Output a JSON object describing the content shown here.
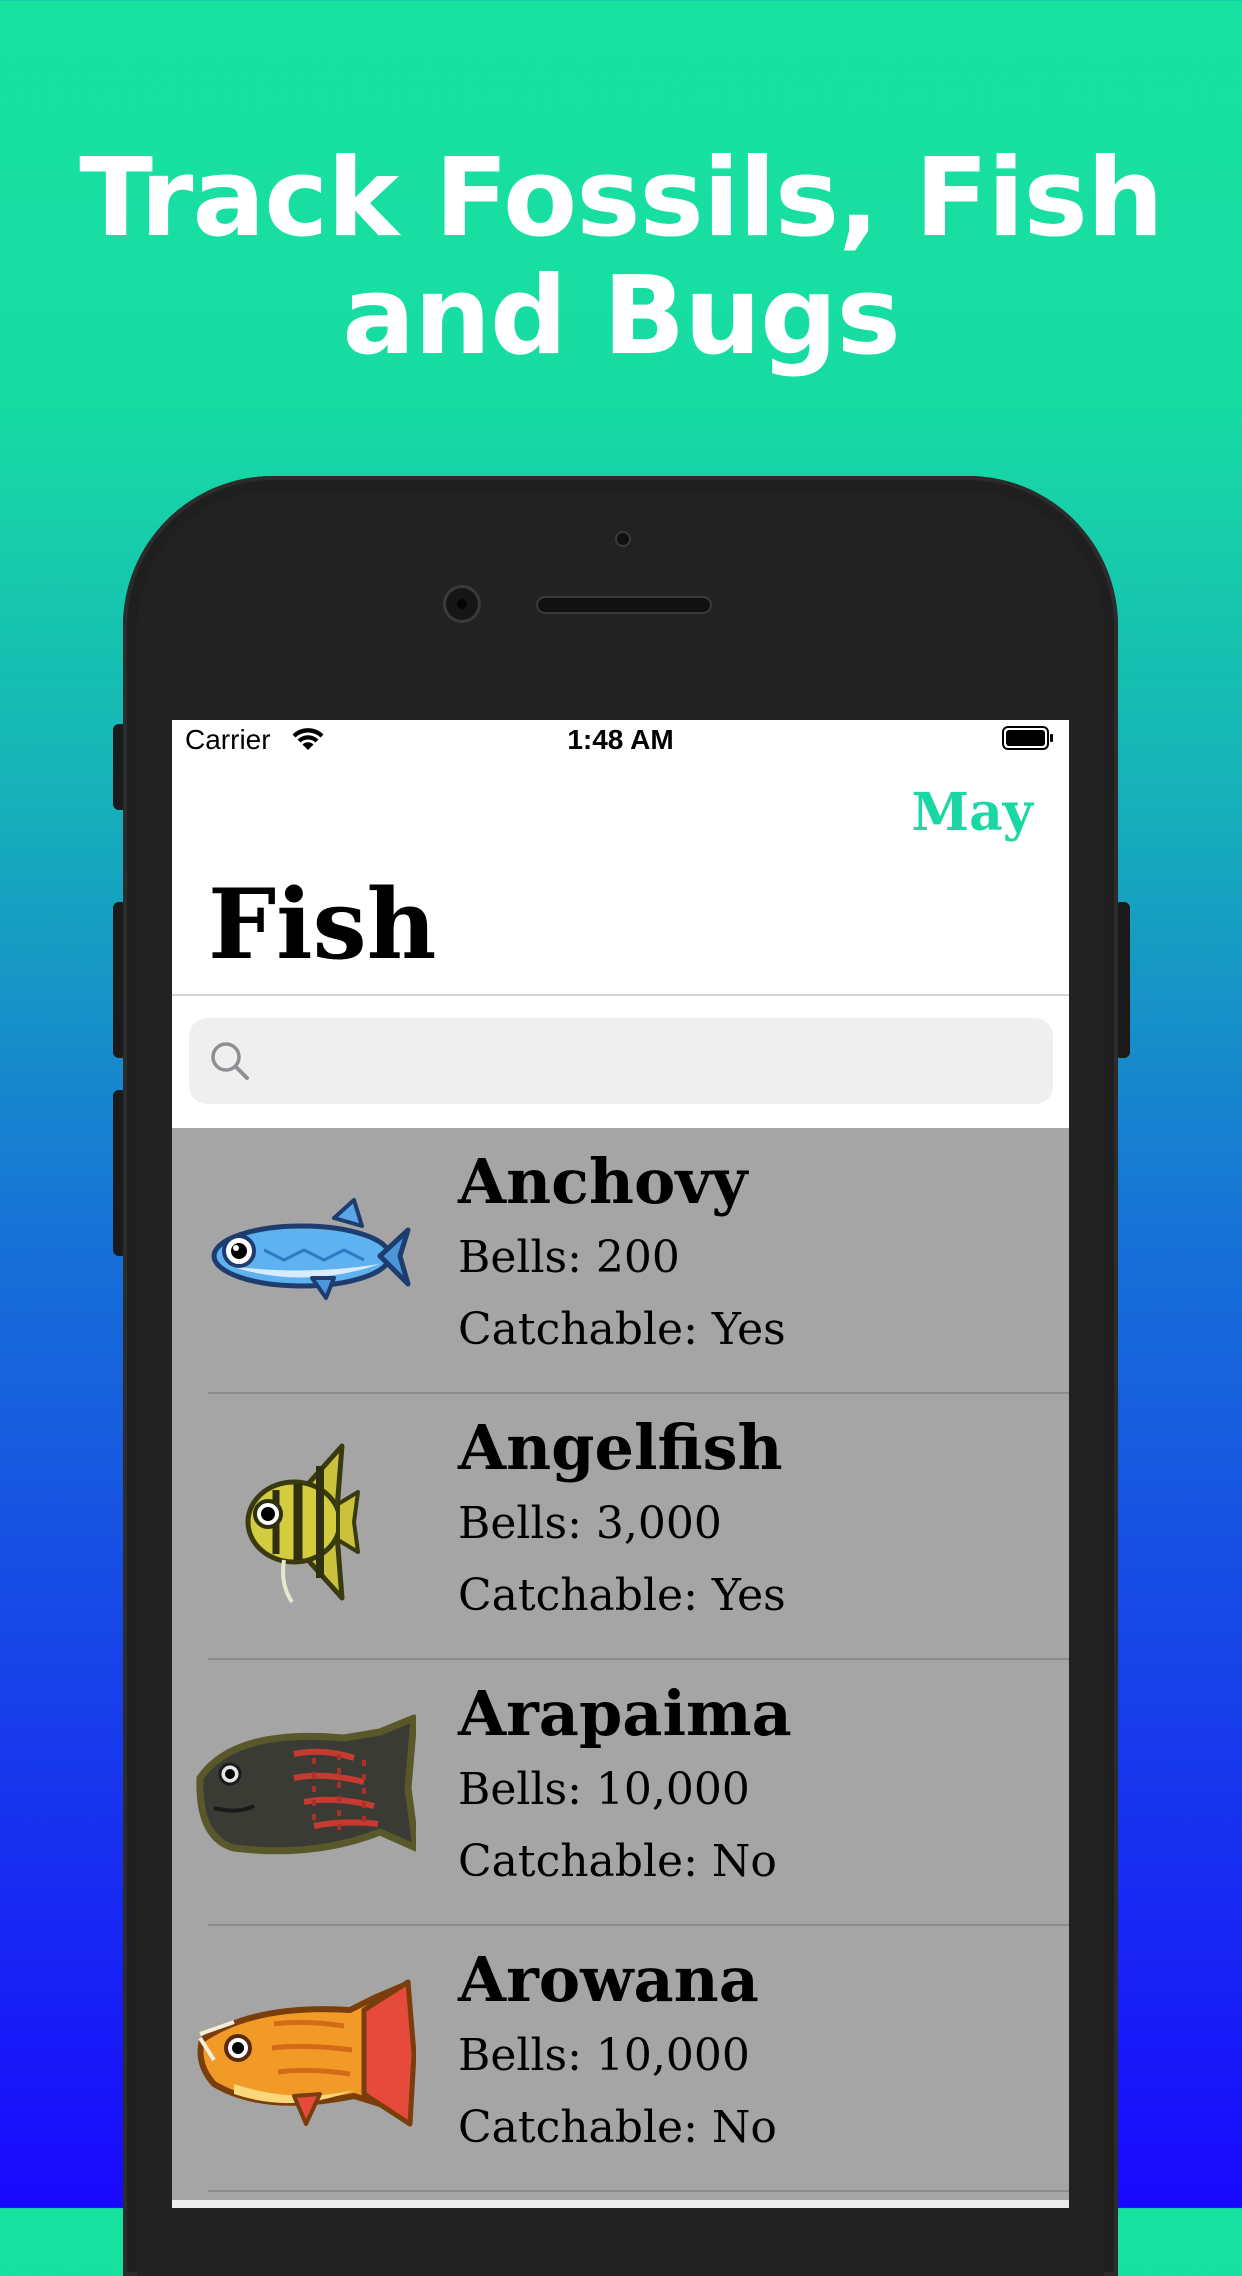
{
  "headline": {
    "line1": "Track Fossils, Fish",
    "line2": "and Bugs"
  },
  "status_bar": {
    "carrier": "Carrier",
    "time": "1:48 AM"
  },
  "nav": {
    "month_button": "May",
    "title": "Fish"
  },
  "search": {
    "placeholder": ""
  },
  "fish": [
    {
      "name": "Anchovy",
      "bells": "Bells: 200",
      "catchable": "Catchable: Yes"
    },
    {
      "name": "Angelfish",
      "bells": "Bells: 3,000",
      "catchable": "Catchable: Yes"
    },
    {
      "name": "Arapaima",
      "bells": "Bells: 10,000",
      "catchable": "Catchable: No"
    },
    {
      "name": "Arowana",
      "bells": "Bells: 10,000",
      "catchable": "Catchable: No"
    }
  ],
  "colors": {
    "accent": "#19d8a4",
    "list_background": "#a5a5a5",
    "gradient_top": "#18e2a0",
    "gradient_bottom": "#1808ff"
  }
}
